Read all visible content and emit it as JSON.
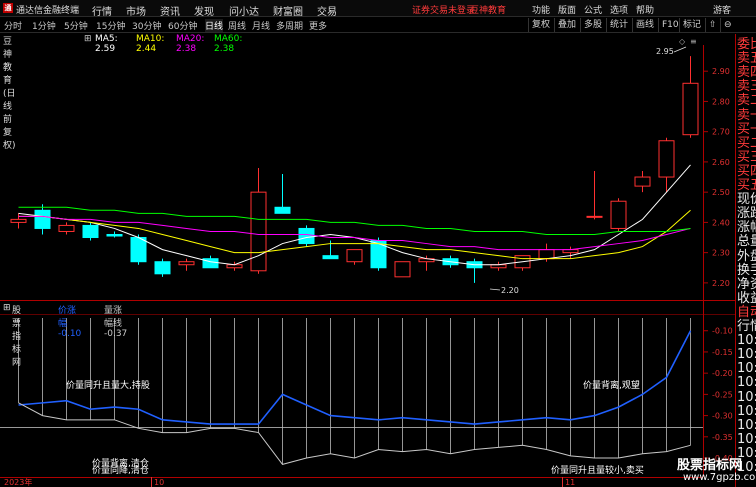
{
  "window": {
    "app_title": "通达信金融终端",
    "menus": [
      "行情",
      "市场",
      "资讯",
      "发现",
      "问小达",
      "财富圈",
      "交易"
    ],
    "notices": [
      "证券交易未登录",
      "豆神教育"
    ],
    "right_menus": [
      "功能",
      "版面",
      "公式",
      "选项",
      "帮助"
    ],
    "user": "游客"
  },
  "period_tabs": [
    "分时",
    "1分钟",
    "5分钟",
    "15分钟",
    "30分钟",
    "60分钟",
    "日线",
    "周线",
    "月线",
    "多周期",
    "更多"
  ],
  "active_period": "日线",
  "tools": [
    "复权",
    "叠加",
    "多股",
    "统计",
    "画线",
    "F10",
    "标记",
    "⇧",
    "⊖"
  ],
  "stock": {
    "name": "豆神教育(日线 前复权)",
    "ma_labels": [
      "MA5: 2.59",
      "MA10: 2.44",
      "MA20: 2.38",
      "MA60: 2.38"
    ],
    "ma_colors": [
      "#ffffff",
      "#ffff00",
      "#ff00ff",
      "#00ff00"
    ]
  },
  "indicator": {
    "name": "股票指标网",
    "labels": [
      "价涨幅 -0.10",
      "量涨幅线 -0.37"
    ],
    "colors": [
      "#2060ff",
      "#c8c8c8"
    ]
  },
  "price_axis": [
    "2.90",
    "2.80",
    "2.70",
    "2.60",
    "2.50",
    "2.40",
    "2.30",
    "2.20"
  ],
  "ind_axis": [
    "-0.10",
    "-0.15",
    "-0.20",
    "-0.25",
    "-0.30",
    "-0.35",
    "-0.40"
  ],
  "date_labels": [
    "2023年",
    "10",
    "11"
  ],
  "price_marks": {
    "high": "2.95",
    "low": "2.20"
  },
  "annotations": [
    "价量同升且量大,持股",
    "价量背离,清仓",
    "价量同降,清仓",
    "价量背离,观望",
    "价量同升且量较小,卖买"
  ],
  "right_panel": [
    "委比",
    "卖五",
    "卖四",
    "卖三",
    "卖二",
    "卖一",
    "买一",
    "买二",
    "买三",
    "买四",
    "买五",
    "现价",
    "涨跌",
    "涨幅",
    "总量",
    "外盘",
    "换手",
    "净资",
    "收益",
    "自动",
    "行情",
    "10:5",
    "10:5",
    "10:5",
    "10:5",
    "10:5",
    "10:5",
    "10:5",
    "10:5",
    "10:5",
    "10:5"
  ],
  "watermark": {
    "title": "股票指标网",
    "url": "www.7gpzb.com"
  },
  "chart_data": [
    {
      "type": "candlestick",
      "title": "豆神教育(日线 前复权)",
      "ylim": [
        2.15,
        2.98
      ],
      "candles": [
        {
          "o": 2.4,
          "h": 2.43,
          "l": 2.38,
          "c": 2.41
        },
        {
          "o": 2.44,
          "h": 2.46,
          "l": 2.36,
          "c": 2.38
        },
        {
          "o": 2.37,
          "h": 2.4,
          "l": 2.36,
          "c": 2.39
        },
        {
          "o": 2.39,
          "h": 2.4,
          "l": 2.34,
          "c": 2.35
        },
        {
          "o": 2.36,
          "h": 2.37,
          "l": 2.35,
          "c": 2.355
        },
        {
          "o": 2.35,
          "h": 2.36,
          "l": 2.26,
          "c": 2.27
        },
        {
          "o": 2.27,
          "h": 2.28,
          "l": 2.22,
          "c": 2.23
        },
        {
          "o": 2.26,
          "h": 2.28,
          "l": 2.24,
          "c": 2.27
        },
        {
          "o": 2.28,
          "h": 2.29,
          "l": 2.25,
          "c": 2.25
        },
        {
          "o": 2.25,
          "h": 2.27,
          "l": 2.24,
          "c": 2.26
        },
        {
          "o": 2.24,
          "h": 2.58,
          "l": 2.23,
          "c": 2.5
        },
        {
          "o": 2.45,
          "h": 2.56,
          "l": 2.43,
          "c": 2.43
        },
        {
          "o": 2.38,
          "h": 2.39,
          "l": 2.32,
          "c": 2.33
        },
        {
          "o": 2.29,
          "h": 2.34,
          "l": 2.28,
          "c": 2.28
        },
        {
          "o": 2.27,
          "h": 2.3,
          "l": 2.26,
          "c": 2.31
        },
        {
          "o": 2.34,
          "h": 2.35,
          "l": 2.24,
          "c": 2.25
        },
        {
          "o": 2.22,
          "h": 2.27,
          "l": 2.22,
          "c": 2.27
        },
        {
          "o": 2.27,
          "h": 2.29,
          "l": 2.24,
          "c": 2.28
        },
        {
          "o": 2.28,
          "h": 2.29,
          "l": 2.25,
          "c": 2.26
        },
        {
          "o": 2.27,
          "h": 2.28,
          "l": 2.2,
          "c": 2.25
        },
        {
          "o": 2.25,
          "h": 2.27,
          "l": 2.24,
          "c": 2.26
        },
        {
          "o": 2.25,
          "h": 2.29,
          "l": 2.24,
          "c": 2.29
        },
        {
          "o": 2.28,
          "h": 2.33,
          "l": 2.27,
          "c": 2.31
        },
        {
          "o": 2.3,
          "h": 2.32,
          "l": 2.28,
          "c": 2.31
        },
        {
          "o": 2.42,
          "h": 2.57,
          "l": 2.41,
          "c": 2.42
        },
        {
          "o": 2.38,
          "h": 2.48,
          "l": 2.37,
          "c": 2.47
        },
        {
          "o": 2.52,
          "h": 2.57,
          "l": 2.5,
          "c": 2.55
        },
        {
          "o": 2.55,
          "h": 2.68,
          "l": 2.5,
          "c": 2.67
        },
        {
          "o": 2.69,
          "h": 2.95,
          "l": 2.68,
          "c": 2.86
        }
      ],
      "ma_series": [
        {
          "name": "MA5",
          "color": "#ffffff",
          "values": [
            2.43,
            2.42,
            2.41,
            2.4,
            2.38,
            2.35,
            2.31,
            2.29,
            2.27,
            2.26,
            2.29,
            2.33,
            2.35,
            2.36,
            2.35,
            2.33,
            2.3,
            2.28,
            2.27,
            2.26,
            2.26,
            2.27,
            2.28,
            2.29,
            2.31,
            2.36,
            2.41,
            2.5,
            2.59
          ]
        },
        {
          "name": "MA10",
          "color": "#ffff00",
          "values": [
            2.42,
            2.42,
            2.41,
            2.4,
            2.39,
            2.38,
            2.36,
            2.34,
            2.32,
            2.3,
            2.3,
            2.31,
            2.32,
            2.33,
            2.33,
            2.33,
            2.32,
            2.31,
            2.31,
            2.3,
            2.29,
            2.28,
            2.28,
            2.28,
            2.29,
            2.3,
            2.32,
            2.37,
            2.44
          ]
        },
        {
          "name": "MA20",
          "color": "#ff00ff",
          "values": [
            2.42,
            2.42,
            2.41,
            2.41,
            2.4,
            2.4,
            2.39,
            2.38,
            2.37,
            2.37,
            2.36,
            2.36,
            2.36,
            2.35,
            2.35,
            2.34,
            2.34,
            2.33,
            2.32,
            2.32,
            2.31,
            2.31,
            2.31,
            2.31,
            2.32,
            2.33,
            2.34,
            2.36,
            2.38
          ]
        },
        {
          "name": "MA60",
          "color": "#00ff00",
          "values": [
            2.45,
            2.45,
            2.45,
            2.44,
            2.44,
            2.43,
            2.43,
            2.42,
            2.42,
            2.42,
            2.41,
            2.41,
            2.41,
            2.4,
            2.4,
            2.39,
            2.39,
            2.38,
            2.38,
            2.37,
            2.37,
            2.37,
            2.36,
            2.36,
            2.36,
            2.37,
            2.37,
            2.37,
            2.38
          ]
        }
      ]
    },
    {
      "type": "line",
      "title": "股票指标网",
      "ylim": [
        -0.44,
        -0.07
      ],
      "series": [
        {
          "name": "价涨幅",
          "color": "#2060ff",
          "values": [
            -0.275,
            -0.27,
            -0.265,
            -0.285,
            -0.28,
            -0.285,
            -0.31,
            -0.315,
            -0.32,
            -0.32,
            -0.32,
            -0.25,
            -0.275,
            -0.3,
            -0.305,
            -0.31,
            -0.305,
            -0.31,
            -0.315,
            -0.32,
            -0.315,
            -0.31,
            -0.305,
            -0.31,
            -0.3,
            -0.28,
            -0.25,
            -0.21,
            -0.1
          ]
        },
        {
          "name": "量涨幅线",
          "color": "#c8c8c8",
          "values": [
            -0.27,
            -0.3,
            -0.31,
            -0.31,
            -0.31,
            -0.33,
            -0.34,
            -0.34,
            -0.33,
            -0.33,
            -0.34,
            -0.415,
            -0.4,
            -0.39,
            -0.4,
            -0.38,
            -0.385,
            -0.38,
            -0.39,
            -0.38,
            -0.375,
            -0.37,
            -0.38,
            -0.395,
            -0.4,
            -0.4,
            -0.39,
            -0.385,
            -0.37
          ]
        }
      ]
    }
  ]
}
